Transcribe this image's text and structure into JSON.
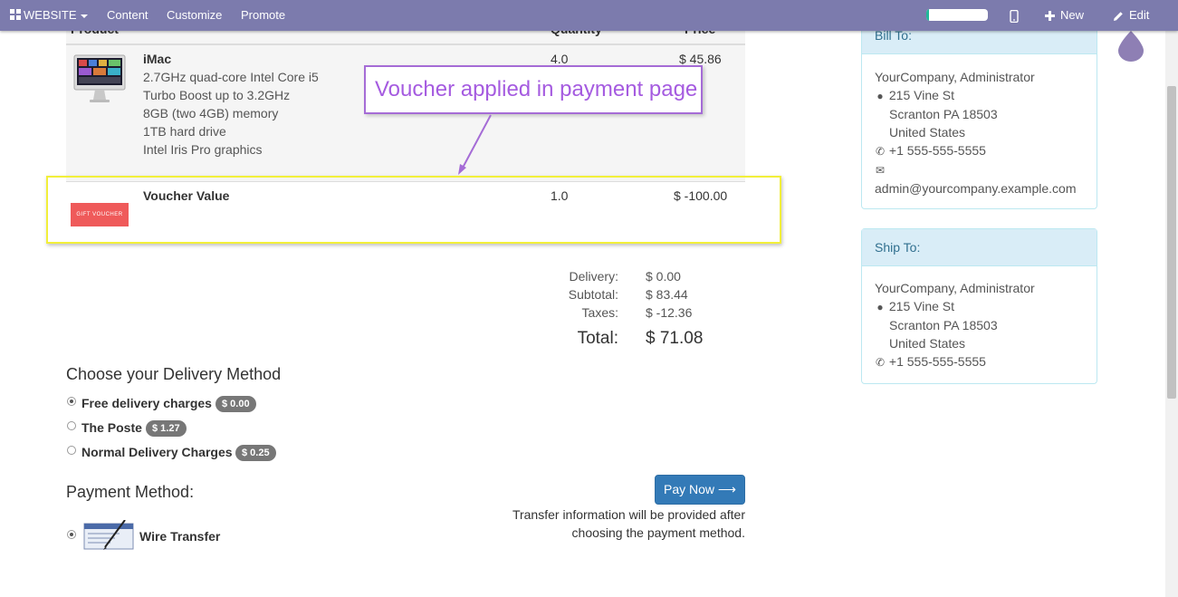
{
  "topbar": {
    "website": "WEBSITE",
    "content": "Content",
    "customize": "Customize",
    "promote": "Promote",
    "new": "New",
    "edit": "Edit",
    "progress": 0.05
  },
  "cart": {
    "headers": {
      "product": "Product",
      "quantity": "Quantity",
      "price": "Price"
    },
    "items": [
      {
        "name": "iMac",
        "description": [
          "2.7GHz quad-core Intel Core i5",
          "Turbo Boost up to 3.2GHz",
          "8GB (two 4GB) memory",
          "1TB hard drive",
          "Intel Iris Pro graphics"
        ],
        "quantity": "4.0",
        "price": "$ 45.86"
      },
      {
        "name": "Voucher Value",
        "image_text": "GIFT VOUCHER",
        "quantity": "1.0",
        "price": "$ -100.00"
      }
    ]
  },
  "annotation": {
    "callout": "Voucher applied in payment page",
    "box_color": "#f2ef3a",
    "callout_color": "#a55be0"
  },
  "totals": {
    "delivery_label": "Delivery:",
    "delivery": "$ 0.00",
    "subtotal_label": "Subtotal:",
    "subtotal": "$ 83.44",
    "taxes_label": "Taxes:",
    "taxes": "$ -12.36",
    "total_label": "Total:",
    "total": "$ 71.08"
  },
  "delivery": {
    "title": "Choose your Delivery Method",
    "options": [
      {
        "label": "Free delivery charges",
        "price": "$ 0.00",
        "selected": true
      },
      {
        "label": "The Poste",
        "price": "$ 1.27",
        "selected": false
      },
      {
        "label": "Normal Delivery Charges",
        "price": "$ 0.25",
        "selected": false
      }
    ]
  },
  "payment": {
    "title": "Payment Method:",
    "method": "Wire Transfer",
    "pay_button": "Pay Now ⟶",
    "info_line1": "Transfer information will be provided after",
    "info_line2": "choosing the payment method."
  },
  "bill_to": {
    "title": "Bill To:",
    "name": "YourCompany, Administrator",
    "street": "215 Vine St",
    "city": "Scranton PA 18503",
    "country": "United States",
    "phone": "+1 555-555-5555",
    "email": "admin@yourcompany.example.com"
  },
  "ship_to": {
    "title": "Ship To:",
    "name": "YourCompany, Administrator",
    "street": "215 Vine St",
    "city": "Scranton PA 18503",
    "country": "United States",
    "phone": "+1 555-555-5555"
  },
  "colors": {
    "topbar": "#7c7bad",
    "primary_button": "#337ab7",
    "panel_header": "#d9edf7"
  }
}
